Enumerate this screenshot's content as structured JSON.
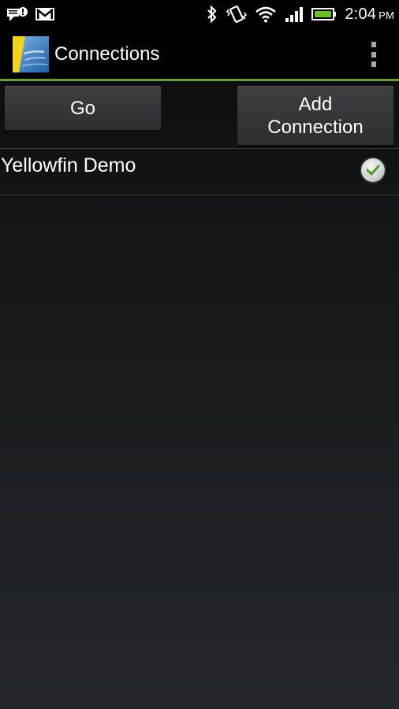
{
  "status_bar": {
    "time": "2:04",
    "ampm": "PM",
    "icons": [
      "notification-icon",
      "gmail-icon",
      "bluetooth-icon",
      "vibrate-icon",
      "wifi-icon",
      "signal-icon",
      "battery-icon"
    ]
  },
  "action_bar": {
    "title": "Connections",
    "app_icon": "yellowfin-app-icon",
    "menu_icon": "overflow-menu-icon"
  },
  "buttons": {
    "go_label": "Go",
    "add_line1": "Add",
    "add_line2": "Connection"
  },
  "connections": [
    {
      "name": "Yellowfin Demo",
      "selected": true
    }
  ],
  "colors": {
    "accent": "#6a9e2c",
    "battery": "#6bbf2a"
  }
}
